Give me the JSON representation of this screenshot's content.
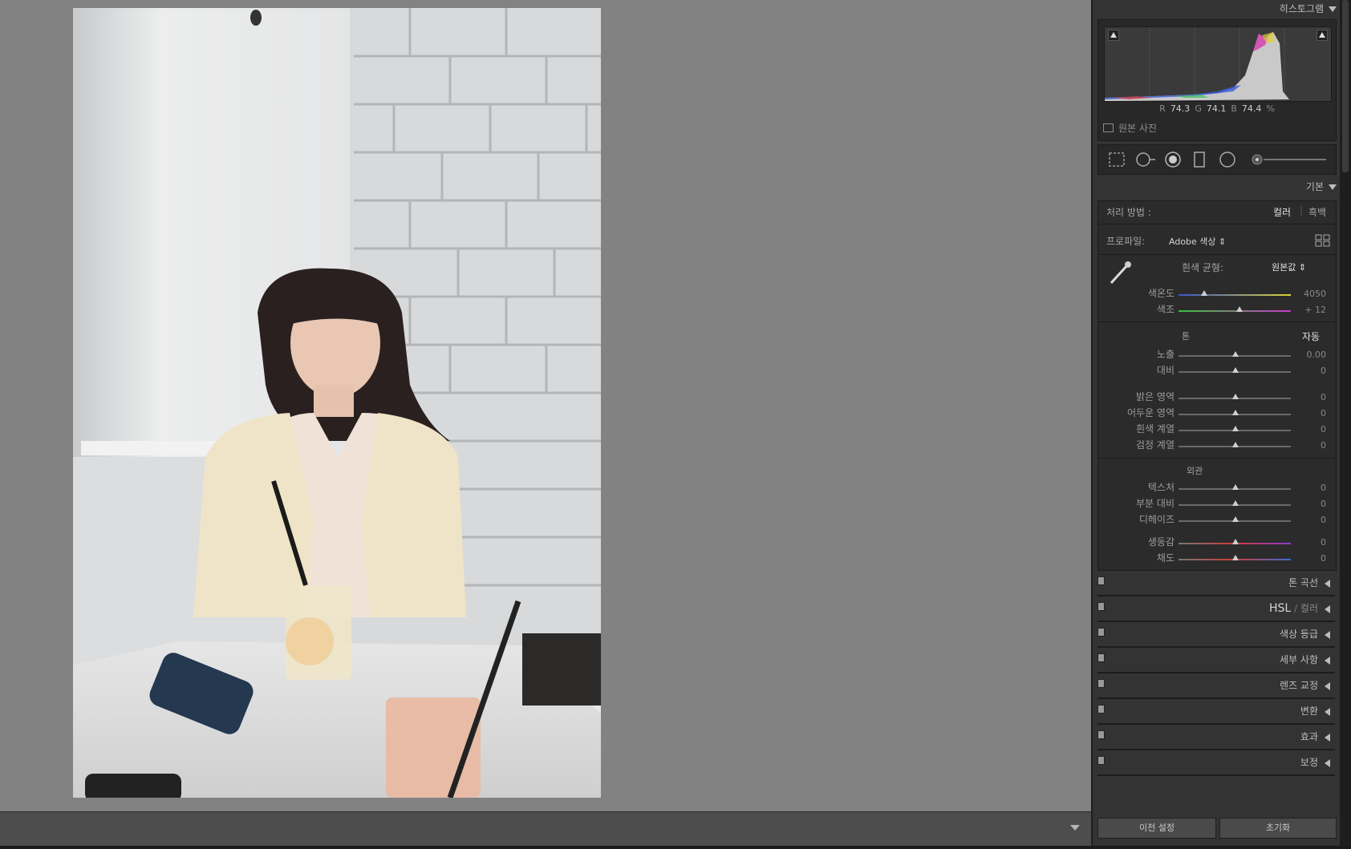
{
  "right_panel": {
    "histogram_title": "히스토그램",
    "rgb": {
      "r_label": "R",
      "r_value": "74.3",
      "g_label": "G",
      "g_value": "74.1",
      "b_label": "B",
      "b_value": "74.4",
      "unit": "%"
    },
    "original_photo": "원본 사진",
    "basic_title": "기본",
    "treatment_label": "처리 방법 :",
    "treatment_color": "컬러",
    "treatment_bw": "흑백",
    "profile_label": "프로파일:",
    "profile_value": "Adobe 색상",
    "wb_label": "흰색 균형:",
    "wb_value": "원본값",
    "temp_label": "색온도",
    "temp_value": "4050",
    "tint_label": "색조",
    "tint_value": "+ 12",
    "tone_label": "톤",
    "auto_label": "자동",
    "exposure_label": "노출",
    "exposure_value": "0.00",
    "contrast_label": "대비",
    "contrast_value": "0",
    "highlights_label": "밝은 영역",
    "highlights_value": "0",
    "shadows_label": "어두운 영역",
    "shadows_value": "0",
    "whites_label": "흰색 계열",
    "whites_value": "0",
    "blacks_label": "검정 계열",
    "blacks_value": "0",
    "presence_label": "외관",
    "texture_label": "텍스처",
    "texture_value": "0",
    "clarity_label": "부분 대비",
    "clarity_value": "0",
    "dehaze_label": "디헤이즈",
    "dehaze_value": "0",
    "vibrance_label": "생동감",
    "vibrance_value": "0",
    "saturation_label": "채도",
    "saturation_value": "0",
    "panels": {
      "tone_curve": "톤 곡선",
      "hsl": "HSL",
      "hsl_sep": "/",
      "hsl_color": "컬러",
      "color_grading": "색상 등급",
      "detail": "세부 사항",
      "lens": "렌즈 교정",
      "transform": "변환",
      "effects": "효과",
      "calibration": "보정"
    },
    "prev_button": "이전 설정",
    "reset_button": "초기화"
  },
  "colors": {
    "panel_bg": "#333333",
    "canvas_bg": "#828282"
  }
}
